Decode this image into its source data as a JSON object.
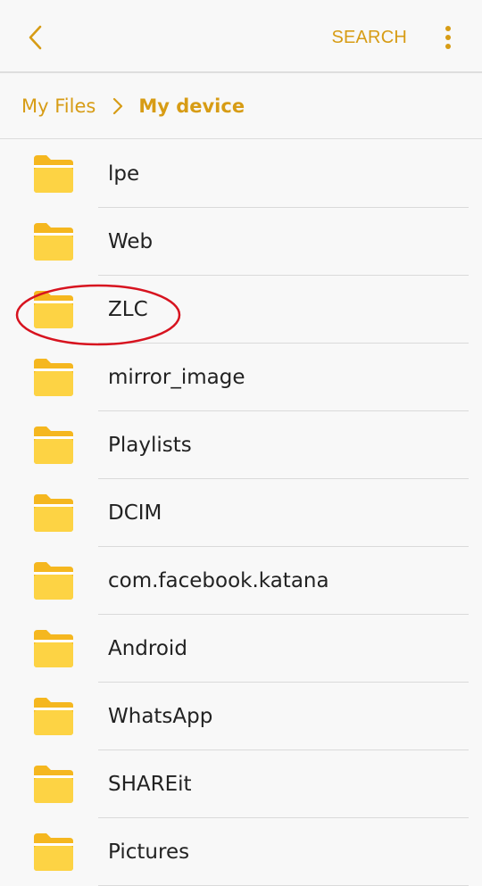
{
  "colors": {
    "accent": "#d79c15",
    "folder_body": "#fdd344",
    "folder_tab": "#f5b71f",
    "annotation": "#d7131f"
  },
  "toolbar": {
    "back_icon": "chevron-left-icon",
    "search_label": "SEARCH",
    "more_icon": "more-vert-icon"
  },
  "breadcrumb": {
    "root": "My Files",
    "separator_icon": "chevron-right-icon",
    "current": "My device"
  },
  "files": [
    {
      "name": "lpe",
      "icon": "folder-icon"
    },
    {
      "name": "Web",
      "icon": "folder-icon"
    },
    {
      "name": "ZLC",
      "icon": "folder-icon"
    },
    {
      "name": "mirror_image",
      "icon": "folder-icon"
    },
    {
      "name": "Playlists",
      "icon": "folder-icon"
    },
    {
      "name": "DCIM",
      "icon": "folder-icon"
    },
    {
      "name": "com.facebook.katana",
      "icon": "folder-icon"
    },
    {
      "name": "Android",
      "icon": "folder-icon"
    },
    {
      "name": "WhatsApp",
      "icon": "folder-icon"
    },
    {
      "name": "SHAREit",
      "icon": "folder-icon"
    },
    {
      "name": "Pictures",
      "icon": "folder-icon"
    }
  ],
  "annotation": {
    "shape": "ellipse",
    "target": "ZLC"
  }
}
